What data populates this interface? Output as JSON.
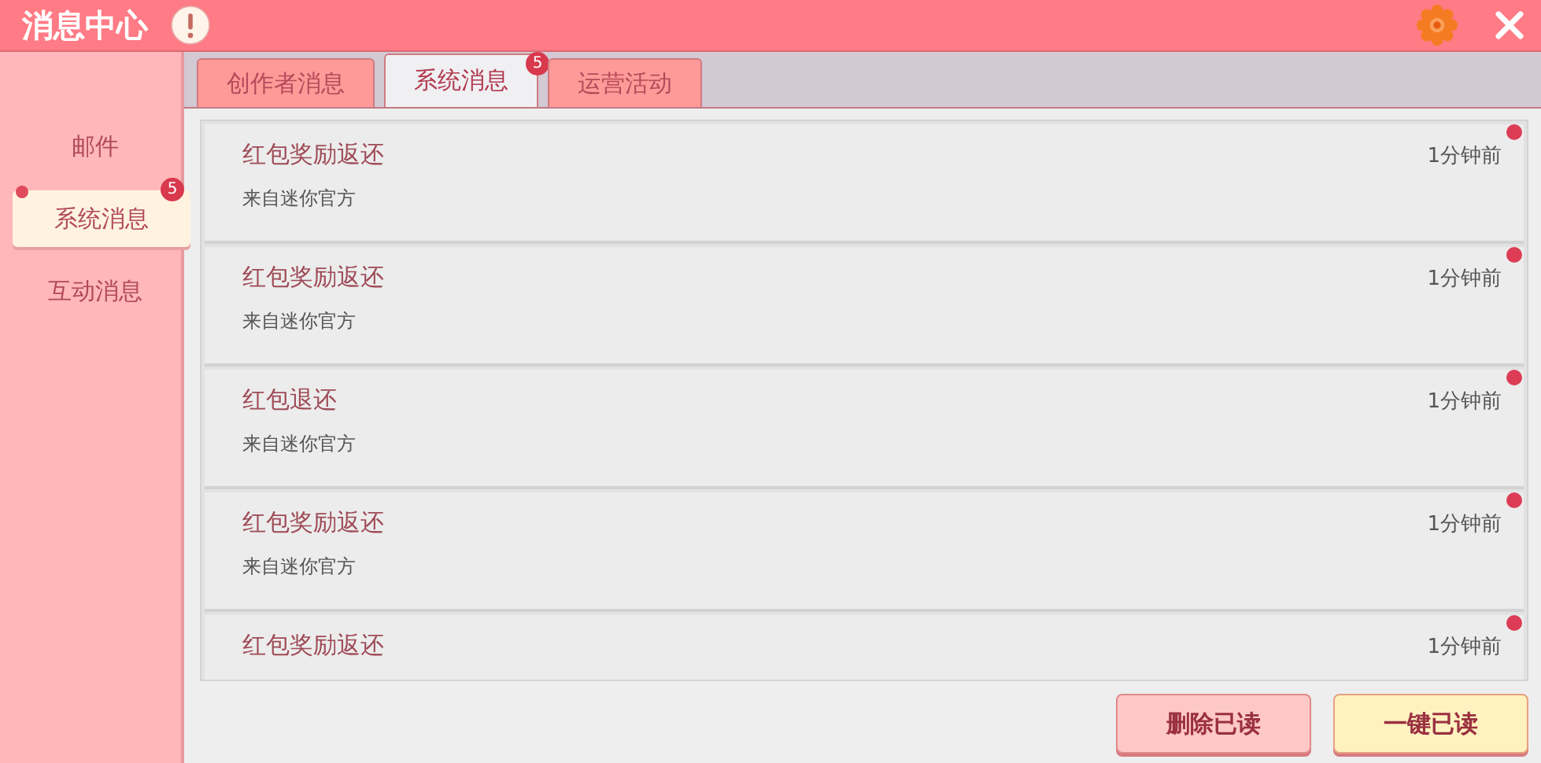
{
  "window": {
    "title": "消息中心"
  },
  "sidebar": {
    "items": [
      {
        "label": "邮件",
        "selected": false,
        "unread": false
      },
      {
        "label": "系统消息",
        "selected": true,
        "unread": true,
        "badge": "5"
      },
      {
        "label": "互动消息",
        "selected": false,
        "unread": false
      }
    ]
  },
  "tabs": [
    {
      "label": "创作者消息",
      "selected": false
    },
    {
      "label": "系统消息",
      "selected": true,
      "badge": "5"
    },
    {
      "label": "运营活动",
      "selected": false
    }
  ],
  "messages": [
    {
      "title": "红包奖励返还",
      "source": "来自迷你官方",
      "time": "1分钟前",
      "unread": true
    },
    {
      "title": "红包奖励返还",
      "source": "来自迷你官方",
      "time": "1分钟前",
      "unread": true
    },
    {
      "title": "红包退还",
      "source": "来自迷你官方",
      "time": "1分钟前",
      "unread": true
    },
    {
      "title": "红包奖励返还",
      "source": "来自迷你官方",
      "time": "1分钟前",
      "unread": true
    },
    {
      "title": "红包奖励返还",
      "time": "1分钟前",
      "unread": true
    }
  ],
  "buttons": [
    {
      "label": "删除已读",
      "kind": "secondary"
    },
    {
      "label": "一键已读",
      "kind": "primary"
    }
  ]
}
